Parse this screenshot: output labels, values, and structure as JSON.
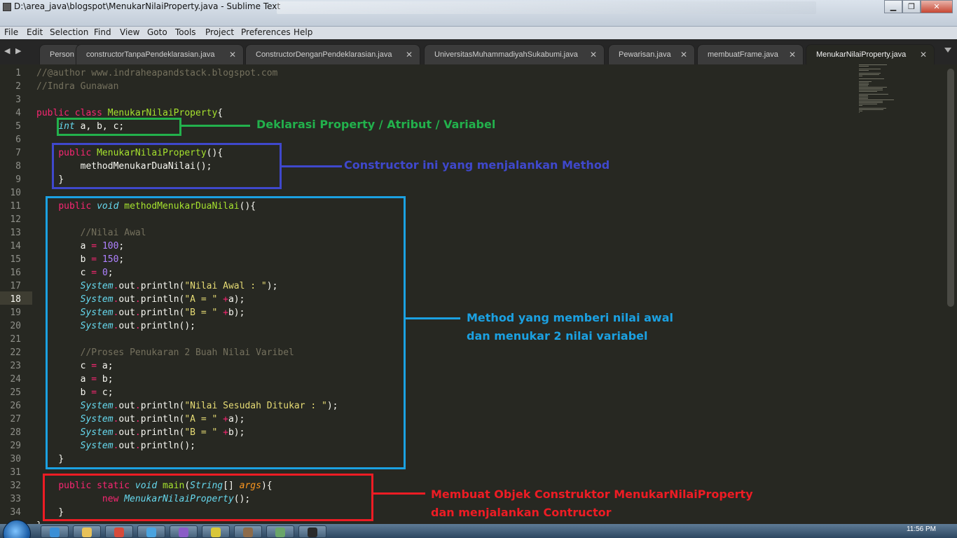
{
  "window": {
    "title": "D:\\area_java\\blogspot\\MenukarNilaiProperty.java - Sublime Text",
    "minimize": "▁",
    "maximize": "❐",
    "close": "✕"
  },
  "menu": [
    "File",
    "Edit",
    "Selection",
    "Find",
    "View",
    "Goto",
    "Tools",
    "Project",
    "Preferences",
    "Help"
  ],
  "tabs": [
    {
      "label": "Person",
      "close": "✕"
    },
    {
      "label": "constructorTanpaPendeklarasian.java",
      "close": "✕"
    },
    {
      "label": "ConstructorDenganPendeklarasian.java",
      "close": "✕"
    },
    {
      "label": "UniversitasMuhammadiyahSukabumi.java",
      "close": "✕"
    },
    {
      "label": "Pewarisan.java",
      "close": "✕"
    },
    {
      "label": "membuatFrame.java",
      "close": "✕"
    },
    {
      "label": "MenukarNilaiProperty.java",
      "close": "✕"
    }
  ],
  "editor": {
    "current_line": 18,
    "lines": [
      [
        {
          "t": "//@author www.indraheapandstack.blogspot.com",
          "c": "cm"
        }
      ],
      [
        {
          "t": "//Indra Gunawan",
          "c": "cm"
        }
      ],
      [],
      [
        {
          "t": "public class ",
          "c": "kw"
        },
        {
          "t": "MenukarNilaiProperty",
          "c": "cl"
        },
        {
          "t": "{",
          "c": ""
        }
      ],
      [
        {
          "t": "    ",
          "c": ""
        },
        {
          "t": "int",
          "c": "ty"
        },
        {
          "t": " a, b, c;",
          "c": ""
        }
      ],
      [],
      [
        {
          "t": "    ",
          "c": ""
        },
        {
          "t": "public ",
          "c": "kw"
        },
        {
          "t": "MenukarNilaiProperty",
          "c": "cl"
        },
        {
          "t": "(){",
          "c": ""
        }
      ],
      [
        {
          "t": "        methodMenukarDuaNilai();",
          "c": ""
        }
      ],
      [
        {
          "t": "    }",
          "c": ""
        }
      ],
      [],
      [
        {
          "t": "    ",
          "c": ""
        },
        {
          "t": "public ",
          "c": "kw"
        },
        {
          "t": "void",
          "c": "ty"
        },
        {
          "t": " ",
          "c": ""
        },
        {
          "t": "methodMenukarDuaNilai",
          "c": "cl"
        },
        {
          "t": "(){",
          "c": ""
        }
      ],
      [],
      [
        {
          "t": "        ",
          "c": ""
        },
        {
          "t": "//Nilai Awal",
          "c": "cm"
        }
      ],
      [
        {
          "t": "        a ",
          "c": ""
        },
        {
          "t": "=",
          "c": "op"
        },
        {
          "t": " ",
          "c": ""
        },
        {
          "t": "100",
          "c": "nm"
        },
        {
          "t": ";",
          "c": ""
        }
      ],
      [
        {
          "t": "        b ",
          "c": ""
        },
        {
          "t": "=",
          "c": "op"
        },
        {
          "t": " ",
          "c": ""
        },
        {
          "t": "150",
          "c": "nm"
        },
        {
          "t": ";",
          "c": ""
        }
      ],
      [
        {
          "t": "        c ",
          "c": ""
        },
        {
          "t": "=",
          "c": "op"
        },
        {
          "t": " ",
          "c": ""
        },
        {
          "t": "0",
          "c": "nm"
        },
        {
          "t": ";",
          "c": ""
        }
      ],
      [
        {
          "t": "        ",
          "c": ""
        },
        {
          "t": "System",
          "c": "it"
        },
        {
          "t": ".",
          "c": "op"
        },
        {
          "t": "out",
          "c": ""
        },
        {
          "t": ".",
          "c": "op"
        },
        {
          "t": "println(",
          "c": ""
        },
        {
          "t": "\"Nilai Awal : \"",
          "c": "st"
        },
        {
          "t": ");",
          "c": ""
        }
      ],
      [
        {
          "t": "        ",
          "c": ""
        },
        {
          "t": "System",
          "c": "it"
        },
        {
          "t": ".",
          "c": "op"
        },
        {
          "t": "out",
          "c": ""
        },
        {
          "t": ".",
          "c": "op"
        },
        {
          "t": "println(",
          "c": ""
        },
        {
          "t": "\"A = \"",
          "c": "st"
        },
        {
          "t": " ",
          "c": ""
        },
        {
          "t": "+",
          "c": "op"
        },
        {
          "t": "a);",
          "c": ""
        }
      ],
      [
        {
          "t": "        ",
          "c": ""
        },
        {
          "t": "System",
          "c": "it"
        },
        {
          "t": ".",
          "c": "op"
        },
        {
          "t": "out",
          "c": ""
        },
        {
          "t": ".",
          "c": "op"
        },
        {
          "t": "println(",
          "c": ""
        },
        {
          "t": "\"B = \"",
          "c": "st"
        },
        {
          "t": " ",
          "c": ""
        },
        {
          "t": "+",
          "c": "op"
        },
        {
          "t": "b);",
          "c": ""
        }
      ],
      [
        {
          "t": "        ",
          "c": ""
        },
        {
          "t": "System",
          "c": "it"
        },
        {
          "t": ".",
          "c": "op"
        },
        {
          "t": "out",
          "c": ""
        },
        {
          "t": ".",
          "c": "op"
        },
        {
          "t": "println();",
          "c": ""
        }
      ],
      [],
      [
        {
          "t": "        ",
          "c": ""
        },
        {
          "t": "//Proses Penukaran 2 Buah Nilai Varibel",
          "c": "cm"
        }
      ],
      [
        {
          "t": "        c ",
          "c": ""
        },
        {
          "t": "=",
          "c": "op"
        },
        {
          "t": " a;",
          "c": ""
        }
      ],
      [
        {
          "t": "        a ",
          "c": ""
        },
        {
          "t": "=",
          "c": "op"
        },
        {
          "t": " b;",
          "c": ""
        }
      ],
      [
        {
          "t": "        b ",
          "c": ""
        },
        {
          "t": "=",
          "c": "op"
        },
        {
          "t": " c;",
          "c": ""
        }
      ],
      [
        {
          "t": "        ",
          "c": ""
        },
        {
          "t": "System",
          "c": "it"
        },
        {
          "t": ".",
          "c": "op"
        },
        {
          "t": "out",
          "c": ""
        },
        {
          "t": ".",
          "c": "op"
        },
        {
          "t": "println(",
          "c": ""
        },
        {
          "t": "\"Nilai Sesudah Ditukar : \"",
          "c": "st"
        },
        {
          "t": ");",
          "c": ""
        }
      ],
      [
        {
          "t": "        ",
          "c": ""
        },
        {
          "t": "System",
          "c": "it"
        },
        {
          "t": ".",
          "c": "op"
        },
        {
          "t": "out",
          "c": ""
        },
        {
          "t": ".",
          "c": "op"
        },
        {
          "t": "println(",
          "c": ""
        },
        {
          "t": "\"A = \"",
          "c": "st"
        },
        {
          "t": " ",
          "c": ""
        },
        {
          "t": "+",
          "c": "op"
        },
        {
          "t": "a);",
          "c": ""
        }
      ],
      [
        {
          "t": "        ",
          "c": ""
        },
        {
          "t": "System",
          "c": "it"
        },
        {
          "t": ".",
          "c": "op"
        },
        {
          "t": "out",
          "c": ""
        },
        {
          "t": ".",
          "c": "op"
        },
        {
          "t": "println(",
          "c": ""
        },
        {
          "t": "\"B = \"",
          "c": "st"
        },
        {
          "t": " ",
          "c": ""
        },
        {
          "t": "+",
          "c": "op"
        },
        {
          "t": "b);",
          "c": ""
        }
      ],
      [
        {
          "t": "        ",
          "c": ""
        },
        {
          "t": "System",
          "c": "it"
        },
        {
          "t": ".",
          "c": "op"
        },
        {
          "t": "out",
          "c": ""
        },
        {
          "t": ".",
          "c": "op"
        },
        {
          "t": "println();",
          "c": ""
        }
      ],
      [
        {
          "t": "    }",
          "c": ""
        }
      ],
      [],
      [
        {
          "t": "    ",
          "c": ""
        },
        {
          "t": "public static ",
          "c": "kw"
        },
        {
          "t": "void",
          "c": "ty"
        },
        {
          "t": " ",
          "c": ""
        },
        {
          "t": "main",
          "c": "cl"
        },
        {
          "t": "(",
          "c": ""
        },
        {
          "t": "String",
          "c": "it"
        },
        {
          "t": "[] ",
          "c": ""
        },
        {
          "t": "args",
          "c": "ar"
        },
        {
          "t": "){",
          "c": ""
        }
      ],
      [
        {
          "t": "            ",
          "c": ""
        },
        {
          "t": "new ",
          "c": "kw"
        },
        {
          "t": "MenukarNilaiProperty",
          "c": "it"
        },
        {
          "t": "();",
          "c": ""
        }
      ],
      [
        {
          "t": "    }",
          "c": ""
        }
      ],
      [
        {
          "t": "}",
          "c": ""
        }
      ]
    ]
  },
  "annotations": {
    "property": {
      "text": "Deklarasi Property / Atribut / Variabel",
      "color": "#22b14c"
    },
    "constructor": {
      "text": "Constructor ini yang menjalankan Method",
      "color": "#3f48cc"
    },
    "method": {
      "line1": "Method yang memberi nilai awal",
      "line2": "dan menukar 2 nilai variabel",
      "color": "#1ba1e2"
    },
    "main": {
      "line1": "Membuat Objek Construktor MenukarNilaiProperty",
      "line2": "dan menjalankan Contructor",
      "color": "#ed1c24"
    }
  },
  "taskbar": {
    "clock": "11:56 PM"
  },
  "theme": {
    "background": "#272822",
    "comment": "#75715e",
    "keyword": "#f92672",
    "type": "#66d9ef",
    "class": "#a6e22e",
    "number": "#ae81ff",
    "string": "#e6db74",
    "argument": "#fd971f"
  }
}
